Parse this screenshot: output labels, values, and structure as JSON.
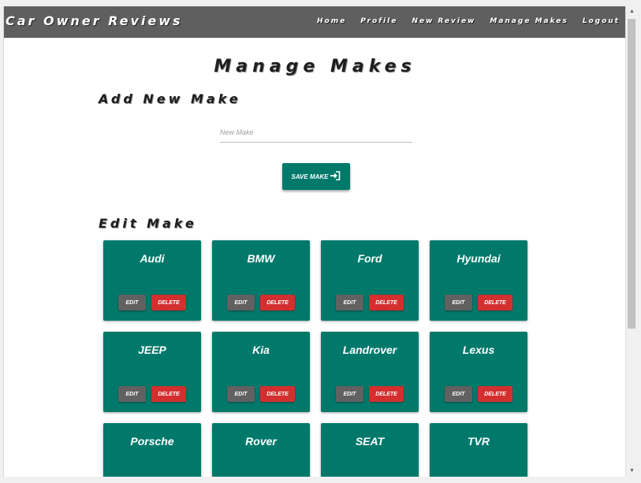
{
  "navbar": {
    "brand": "Car Owner Reviews",
    "links": [
      "Home",
      "Profile",
      "New Review",
      "Manage Makes",
      "Logout"
    ]
  },
  "page_title": "Manage Makes",
  "add_section": {
    "title": "Add New Make",
    "input_placeholder": "New Make",
    "input_value": "",
    "save_label": "save make",
    "save_icon": "sign-in-icon"
  },
  "edit_section": {
    "title": "Edit Make",
    "edit_label": "edit",
    "delete_label": "delete",
    "makes": [
      "Audi",
      "BMW",
      "Ford",
      "Hyundai",
      "JEEP",
      "Kia",
      "Landrover",
      "Lexus",
      "Porsche",
      "Rover",
      "SEAT",
      "TVR"
    ]
  },
  "colors": {
    "navbar": "#5f5f5f",
    "card": "#00796b",
    "edit_button": "#616161",
    "delete_button": "#d32f2f"
  }
}
